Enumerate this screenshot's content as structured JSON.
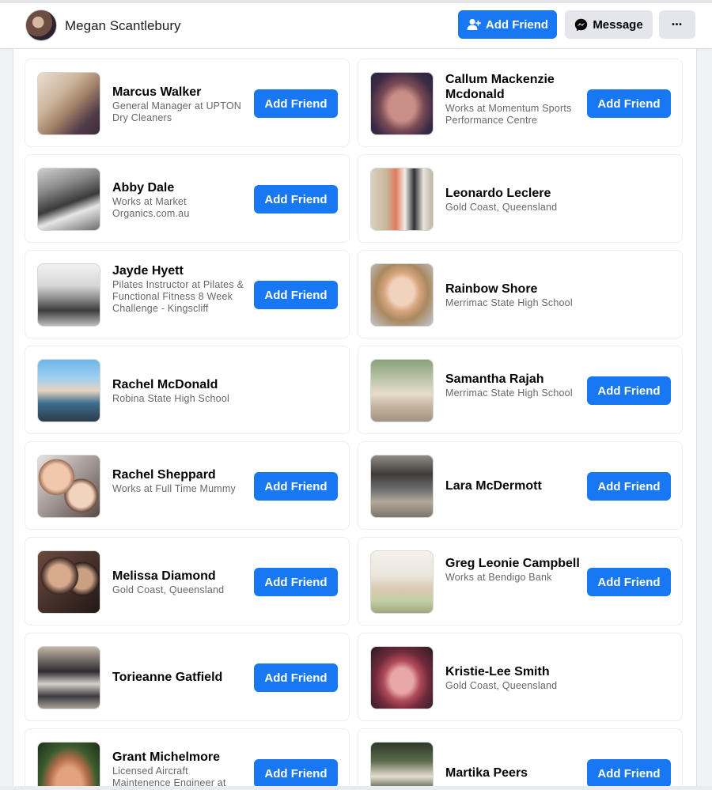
{
  "header": {
    "profile_name": "Megan Scantlebury",
    "add_friend_label": "Add Friend",
    "message_label": "Message",
    "more_label": "•••"
  },
  "colors": {
    "primary": "#1877f2",
    "secondary_button": "#e4e6eb",
    "muted_text": "#65676b"
  },
  "friends": [
    {
      "name": "Marcus Walker",
      "detail": "General Manager at UPTON Dry Cleaners",
      "button": "Add Friend"
    },
    {
      "name": "Callum Mackenzie Mcdonald",
      "detail": "Works at Momentum Sports Performance Centre",
      "button": "Add Friend"
    },
    {
      "name": "Abby Dale",
      "detail": "Works at Market Organics.com.au",
      "button": "Add Friend"
    },
    {
      "name": "Leonardo Leclere",
      "detail": "Gold Coast, Queensland",
      "button": null
    },
    {
      "name": "Jayde Hyett",
      "detail": "Pilates Instructor at Pilates & Functional Fitness 8 Week Challenge - Kingscliff",
      "button": "Add Friend"
    },
    {
      "name": "Rainbow Shore",
      "detail": "Merrimac State High School",
      "button": null
    },
    {
      "name": "Rachel McDonald",
      "detail": "Robina State High School",
      "button": null
    },
    {
      "name": "Samantha Rajah",
      "detail": "Merrimac State High School",
      "button": "Add Friend"
    },
    {
      "name": "Rachel Sheppard",
      "detail": "Works at Full Time Mummy",
      "button": "Add Friend"
    },
    {
      "name": "Lara McDermott",
      "detail": "",
      "button": "Add Friend"
    },
    {
      "name": "Melissa Diamond",
      "detail": "Gold Coast, Queensland",
      "button": "Add Friend"
    },
    {
      "name": "Greg Leonie Campbell",
      "detail": "Works at Bendigo Bank",
      "button": "Add Friend"
    },
    {
      "name": "Torieanne Gatfield",
      "detail": "",
      "button": "Add Friend"
    },
    {
      "name": "Kristie-Lee Smith",
      "detail": "Gold Coast, Queensland",
      "button": null
    },
    {
      "name": "Grant Michelmore",
      "detail": "Licensed Aircraft Maintenence Engineer at",
      "button": "Add Friend"
    },
    {
      "name": "Martika Peers",
      "detail": "",
      "button": "Add Friend"
    }
  ]
}
